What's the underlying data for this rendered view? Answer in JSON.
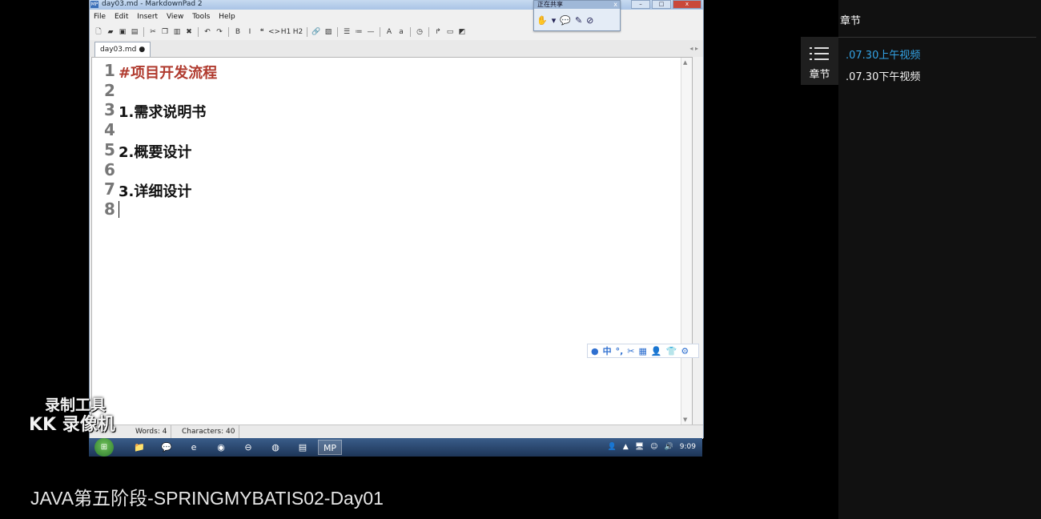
{
  "window": {
    "title": "day03.md - MarkdownPad 2",
    "app_icon": "MP",
    "controls": {
      "minimize": "–",
      "maximize": "□",
      "close": "x"
    }
  },
  "menu": [
    "File",
    "Edit",
    "Insert",
    "View",
    "Tools",
    "Help"
  ],
  "toolbar": [
    {
      "icon": "new-file-icon",
      "glyph": "🗋"
    },
    {
      "icon": "open-folder-icon",
      "glyph": "▰"
    },
    {
      "icon": "save-icon",
      "glyph": "▣"
    },
    {
      "icon": "save-all-icon",
      "glyph": "▤"
    },
    {
      "sep": true
    },
    {
      "icon": "cut-icon",
      "glyph": "✂"
    },
    {
      "icon": "copy-icon",
      "glyph": "❐"
    },
    {
      "icon": "paste-icon",
      "glyph": "▥"
    },
    {
      "icon": "delete-icon",
      "glyph": "✖"
    },
    {
      "sep": true
    },
    {
      "icon": "undo-icon",
      "glyph": "↶"
    },
    {
      "icon": "redo-icon",
      "glyph": "↷"
    },
    {
      "sep": true
    },
    {
      "icon": "bold-icon",
      "glyph": "B"
    },
    {
      "icon": "italic-icon",
      "glyph": "I"
    },
    {
      "icon": "quote-icon",
      "glyph": "❝"
    },
    {
      "icon": "code-icon",
      "glyph": "<>"
    },
    {
      "icon": "heading1-icon",
      "glyph": "H1"
    },
    {
      "icon": "heading2-icon",
      "glyph": "H2"
    },
    {
      "sep": true
    },
    {
      "icon": "link-icon",
      "glyph": "🔗"
    },
    {
      "icon": "image-icon",
      "glyph": "▨"
    },
    {
      "sep": true
    },
    {
      "icon": "bullet-list-icon",
      "glyph": "☰"
    },
    {
      "icon": "numbered-list-icon",
      "glyph": "≔"
    },
    {
      "icon": "horizontal-rule-icon",
      "glyph": "—"
    },
    {
      "sep": true
    },
    {
      "icon": "uppercase-icon",
      "glyph": "A"
    },
    {
      "icon": "lowercase-icon",
      "glyph": "a"
    },
    {
      "sep": true
    },
    {
      "icon": "timestamp-icon",
      "glyph": "◷"
    },
    {
      "sep": true
    },
    {
      "icon": "export-icon",
      "glyph": "↱"
    },
    {
      "icon": "preview-icon",
      "glyph": "▭"
    },
    {
      "icon": "browser-icon",
      "glyph": "◩"
    }
  ],
  "share_panel": {
    "title": "正在共享",
    "close": "x",
    "tools": [
      "✋",
      "▾",
      "💬",
      "✎",
      "⊘"
    ]
  },
  "tab": {
    "label": "day03.md",
    "close": "●"
  },
  "editor": {
    "lines": [
      {
        "n": "1",
        "text": "#项目开发流程",
        "kind": "h1"
      },
      {
        "n": "2",
        "text": "",
        "kind": "p"
      },
      {
        "n": "3",
        "text": "1.需求说明书",
        "kind": "p"
      },
      {
        "n": "4",
        "text": "",
        "kind": "p"
      },
      {
        "n": "5",
        "text": "2.概要设计",
        "kind": "p"
      },
      {
        "n": "6",
        "text": "",
        "kind": "p"
      },
      {
        "n": "7",
        "text": "3.详细设计",
        "kind": "p"
      },
      {
        "n": "8",
        "text": "",
        "kind": "p"
      }
    ]
  },
  "ime_bar": [
    "●",
    "中",
    "°,",
    "✂",
    "▦",
    "👤",
    "👕",
    "⚙"
  ],
  "status": {
    "words": "Words: 4",
    "characters": "Characters: 40"
  },
  "taskbar": {
    "start": "⊞",
    "items": [
      "📁",
      "💬",
      "e",
      "◉",
      "⊖",
      "◍",
      "▤",
      "MP"
    ],
    "active_index": 7,
    "tray": [
      "👤",
      "▲",
      "🖥",
      "☺",
      "🔊"
    ],
    "time": "9:09"
  },
  "watermark": {
    "line1": "录制工具",
    "line2": "KK 录像机"
  },
  "caption": "JAVA第五阶段-SPRINGMYBATIS02-Day01",
  "chapter_button": {
    "label": "章节"
  },
  "panel": {
    "title": "章节",
    "chapters": [
      {
        "label": ".07.30上午视频",
        "active": true
      },
      {
        "label": ".07.30下午视频",
        "active": false
      }
    ]
  },
  "colors": {
    "active_chapter": "#33a3e6",
    "heading_red": "#b03a2e",
    "panel_bg": "#111111"
  }
}
